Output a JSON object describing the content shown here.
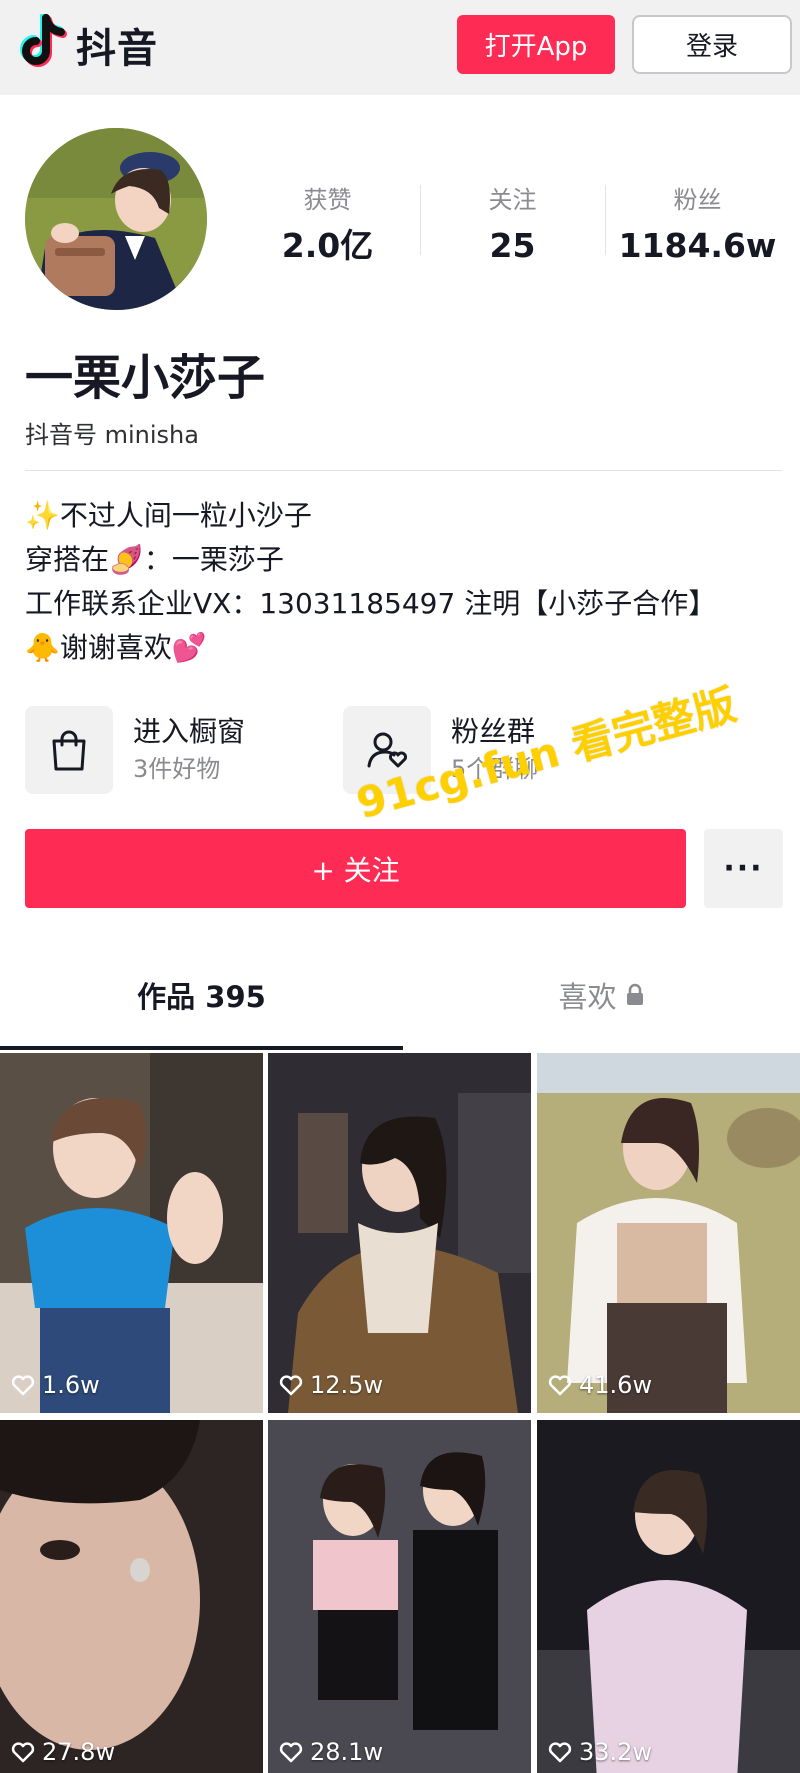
{
  "header": {
    "app_name": "抖音",
    "open_app_label": "打开App",
    "login_label": "登录"
  },
  "profile": {
    "stats": [
      {
        "label": "获赞",
        "value": "2.0亿"
      },
      {
        "label": "关注",
        "value": "25"
      },
      {
        "label": "粉丝",
        "value": "1184.6w"
      }
    ],
    "name": "一栗小莎子",
    "douyin_id": "抖音号 minisha",
    "bio": [
      "✨不过人间一粒小沙子",
      "穿搭在🍠：一栗莎子",
      "工作联系企业VX：13031185497 注明【小莎子合作】",
      "🐥谢谢喜欢💕"
    ]
  },
  "entries": [
    {
      "title": "进入橱窗",
      "subtitle": "3件好物",
      "icon": "shopping-bag-icon"
    },
    {
      "title": "粉丝群",
      "subtitle": "5个群聊",
      "icon": "fan-group-icon"
    }
  ],
  "actions": {
    "follow_label": "+ 关注",
    "more_label": "···"
  },
  "watermark": "91cg.fun 看完整版",
  "tabs": {
    "works": "作品 395",
    "likes": "喜欢"
  },
  "videos": [
    {
      "likes": "1.6w"
    },
    {
      "likes": "12.5w"
    },
    {
      "likes": "41.6w"
    },
    {
      "likes": "27.8w"
    },
    {
      "likes": "28.1w"
    },
    {
      "likes": "33.2w"
    }
  ],
  "colors": {
    "brand_red": "#fe2c55",
    "tiktok_cyan": "#25f4ee",
    "text_primary": "#161823",
    "text_secondary": "#8a8b91",
    "watermark": "#ffd000"
  }
}
